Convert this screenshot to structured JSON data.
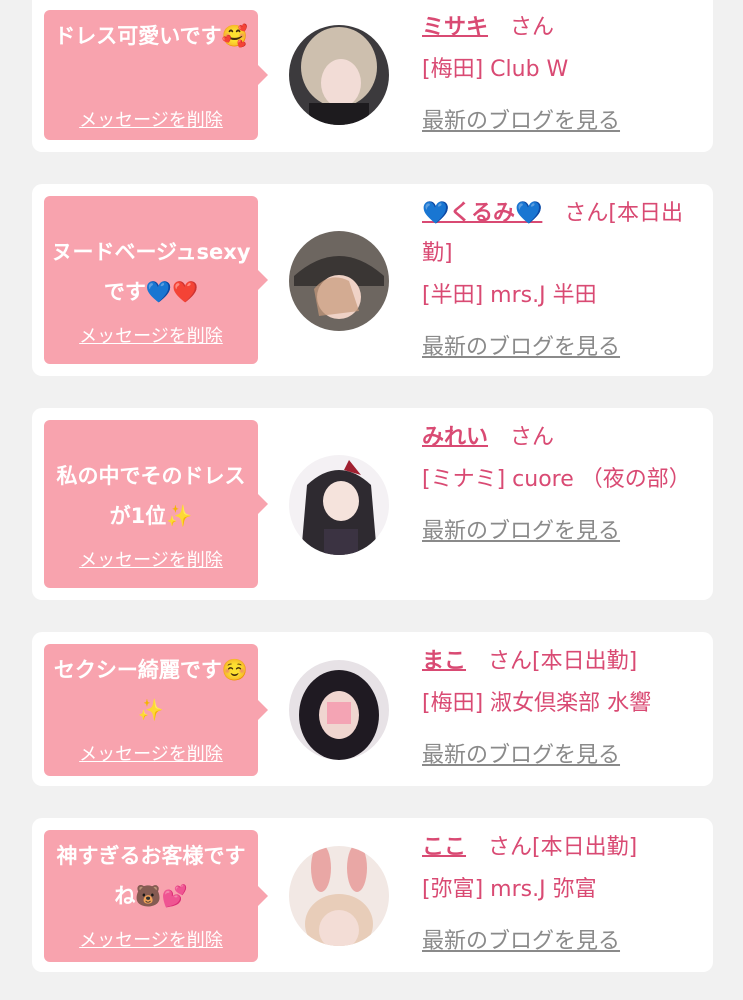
{
  "items": [
    {
      "message": "ドレス可愛いです🥰",
      "delete_label": "メッセージを削除",
      "name": "ミサキ",
      "suffix": "さん",
      "shop": "[梅田] Club W",
      "blog_link": "最新のブログを見る"
    },
    {
      "message": "ヌードベージュsexyです💙❤️",
      "delete_label": "メッセージを削除",
      "name": "💙くるみ💙",
      "suffix": "さん[本日出勤]",
      "shop": "[半田] mrs.J 半田",
      "blog_link": "最新のブログを見る"
    },
    {
      "message": "私の中でそのドレスが1位✨",
      "delete_label": "メッセージを削除",
      "name": "みれい",
      "suffix": "さん",
      "shop": "[ミナミ] cuore （夜の部）",
      "blog_link": "最新のブログを見る"
    },
    {
      "message": "セクシー綺麗です☺️✨",
      "delete_label": "メッセージを削除",
      "name": "まこ",
      "suffix": "さん[本日出勤]",
      "shop": "[梅田] 淑女倶楽部 水響",
      "blog_link": "最新のブログを見る"
    },
    {
      "message": "神すぎるお客様ですね🐻💕",
      "delete_label": "メッセージを削除",
      "name": "ここ",
      "suffix": "さん[本日出勤]",
      "shop": "[弥富] mrs.J 弥富",
      "blog_link": "最新のブログを見る"
    }
  ],
  "colors": {
    "accent": "#d94a73",
    "bubble": "#f8a3ae",
    "link_gray": "#8a8a8a",
    "background": "#f1f1f1"
  }
}
